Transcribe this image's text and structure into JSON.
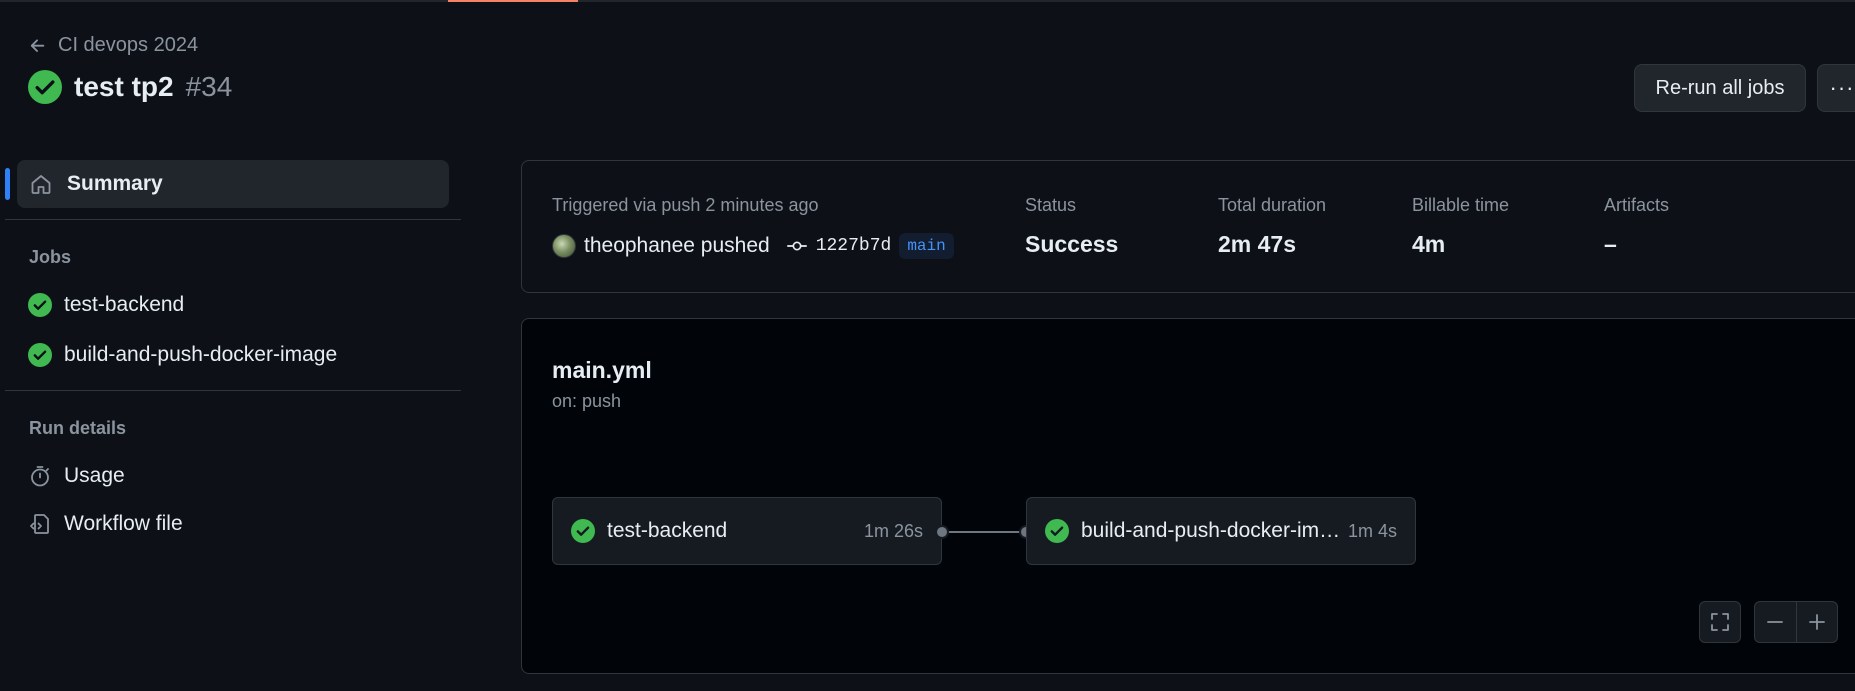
{
  "colors": {
    "background": "#0d1117",
    "success_green": "#3fb950",
    "accent_blue": "#2f81f7",
    "tab_accent": "#f78166",
    "muted_text": "#8b949e"
  },
  "header": {
    "back_label": "CI devops 2024",
    "back_icon": "arrow-left-icon",
    "run_title": "test tp2",
    "run_number": "#34",
    "status_icon": "check-circle-icon",
    "rerun_label": "Re-run all jobs",
    "more_label": "···"
  },
  "sidebar": {
    "summary_label": "Summary",
    "summary_icon": "home-icon",
    "jobs_heading": "Jobs",
    "jobs": [
      {
        "label": "test-backend",
        "icon": "check-circle-icon"
      },
      {
        "label": "build-and-push-docker-image",
        "icon": "check-circle-icon"
      }
    ],
    "run_details_heading": "Run details",
    "run_details": [
      {
        "label": "Usage",
        "icon": "stopwatch-icon"
      },
      {
        "label": "Workflow file",
        "icon": "file-code-icon"
      }
    ]
  },
  "summary": {
    "trigger_text": "Triggered via push 2 minutes ago",
    "pusher": "theophanee pushed",
    "commit_sha": "1227b7d",
    "branch": "main",
    "status_label": "Status",
    "status_value": "Success",
    "duration_label": "Total duration",
    "duration_value": "2m 47s",
    "billable_label": "Billable time",
    "billable_value": "4m",
    "artifacts_label": "Artifacts",
    "artifacts_value": "–"
  },
  "workflow": {
    "name": "main.yml",
    "trigger": "on: push",
    "jobs": [
      {
        "name": "test-backend",
        "duration": "1m 26s"
      },
      {
        "name": "build-and-push-docker-image",
        "duration": "1m 4s"
      }
    ],
    "controls": [
      "fullscreen-icon",
      "zoom-out-icon",
      "zoom-in-icon"
    ]
  }
}
